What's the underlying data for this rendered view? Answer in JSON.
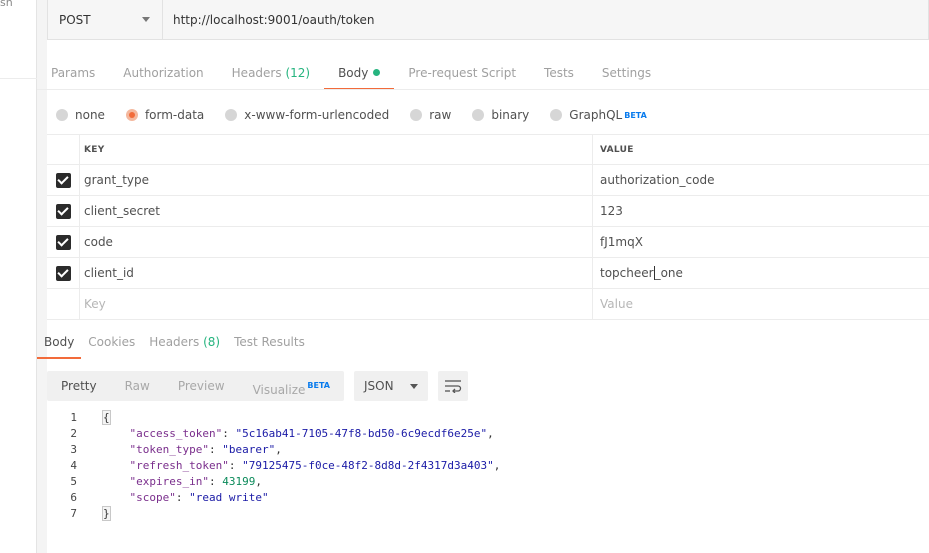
{
  "sidebar": {
    "fragment": "sh"
  },
  "request": {
    "method": "POST",
    "url": "http://localhost:9001/oauth/token"
  },
  "request_tabs": [
    {
      "label": "Params"
    },
    {
      "label": "Authorization"
    },
    {
      "label": "Headers",
      "count": "(12)"
    },
    {
      "label": "Body",
      "active": true
    },
    {
      "label": "Pre-request Script"
    },
    {
      "label": "Tests"
    },
    {
      "label": "Settings"
    }
  ],
  "body_types": {
    "none": "none",
    "form_data": "form-data",
    "urlencoded": "x-www-form-urlencoded",
    "raw": "raw",
    "binary": "binary",
    "graphql": "GraphQL",
    "beta": "BETA",
    "selected": "form-data"
  },
  "params_table": {
    "headers": {
      "key": "KEY",
      "value": "VALUE"
    },
    "rows": [
      {
        "key": "grant_type",
        "value": "authorization_code",
        "checked": true
      },
      {
        "key": "client_secret",
        "value": "123",
        "checked": true
      },
      {
        "key": "code",
        "value": "fJ1mqX",
        "checked": true
      },
      {
        "key": "client_id",
        "value_before_cursor": "topcheer",
        "value_after_cursor": "_one",
        "checked": true
      }
    ],
    "placeholder": {
      "key": "Key",
      "value": "Value"
    }
  },
  "response_tabs": [
    {
      "label": "Body",
      "active": true
    },
    {
      "label": "Cookies"
    },
    {
      "label": "Headers",
      "count": "(8)"
    },
    {
      "label": "Test Results"
    }
  ],
  "response_toolbar": {
    "views": [
      "Pretty",
      "Raw",
      "Preview",
      "Visualize"
    ],
    "beta": "BETA",
    "language": "JSON"
  },
  "response_body": {
    "line_numbers": [
      "1",
      "2",
      "3",
      "4",
      "5",
      "6",
      "7"
    ],
    "open": "{",
    "close": "}",
    "fields": [
      {
        "key": "\"access_token\"",
        "value": "\"5c16ab41-7105-47f8-bd50-6c9ecdf6e25e\"",
        "sep": ","
      },
      {
        "key": "\"token_type\"",
        "value": "\"bearer\"",
        "sep": ","
      },
      {
        "key": "\"refresh_token\"",
        "value": "\"79125475-f0ce-48f2-8d8d-2f4317d3a403\"",
        "sep": ","
      },
      {
        "key": "\"expires_in\"",
        "value": "43199",
        "sep": ","
      },
      {
        "key": "\"scope\"",
        "value": "\"read write\"",
        "sep": ""
      }
    ]
  },
  "colors": {
    "accent": "#f26b3a",
    "count_green": "#26b47f",
    "beta_blue": "#097bed"
  }
}
